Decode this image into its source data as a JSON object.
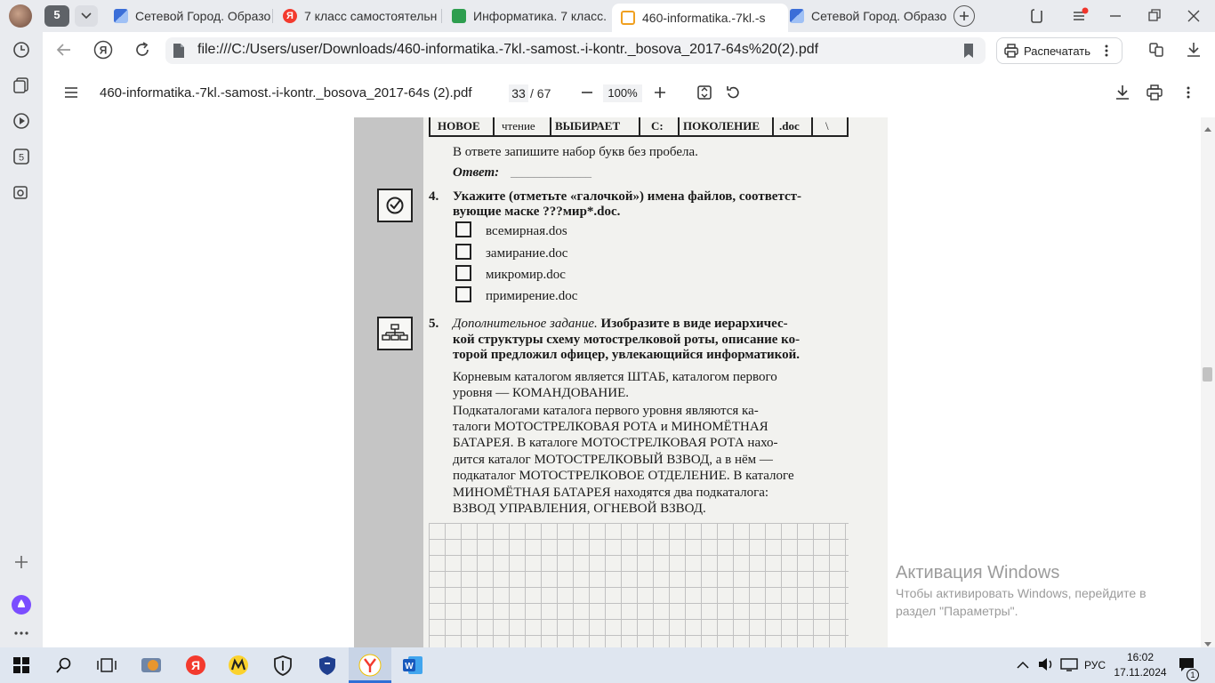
{
  "browser": {
    "tab_count": "5",
    "tabs": [
      {
        "title": "Сетевой Город. Образо",
        "favicon_color": "#3b6ed8",
        "active": false
      },
      {
        "title": "7 класс самостоятельн",
        "favicon_color": "#f33a2e",
        "active": false
      },
      {
        "title": "Информатика. 7 класс.",
        "favicon_color": "#2e9e4f",
        "active": false
      },
      {
        "title": "460-informatika.-7kl.-s",
        "favicon_color": "#f0a020",
        "active": true
      },
      {
        "title": "Сетевой Город. Образо",
        "favicon_color": "#3b6ed8",
        "active": false
      }
    ],
    "address": "file:///C:/Users/user/Downloads/460-informatika.-7kl.-samost.-i-kontr._bosova_2017-64s%20(2).pdf",
    "print_label": "Распечатать"
  },
  "pdf_toolbar": {
    "filename": "460-informatika.-7kl.-samost.-i-kontr._bosova_2017-64s (2).pdf",
    "current_page": "33",
    "total_pages": "/ 67",
    "zoom": "100%"
  },
  "page": {
    "table_cells": [
      "НОВОЕ",
      "чтение",
      "ВЫБИРАЕТ",
      "С:",
      "ПОКОЛЕНИЕ",
      ".doc",
      "\\"
    ],
    "answer_instruction": "В ответе запишите набор букв без пробела.",
    "answer_label": "Ответ:",
    "answer_line": "______________",
    "task4": {
      "number": "4.",
      "line1": "Укажите (отметьте «галочкой») имена файлов, соответст-",
      "line2": "вующие маске ???мир*.doc.",
      "options": [
        "всемирная.dos",
        "замирание.doc",
        "микромир.doc",
        "примирение.doc"
      ]
    },
    "task5": {
      "number": "5.",
      "heading": "Дополнительное задание.",
      "line1_rest": " Изобразите в виде иерархичес-",
      "line2": "кой структуры схему мотострелковой роты, описание ко-",
      "line3": "торой предложил офицер, увлекающийся информатикой.",
      "para1": [
        "Корневым каталогом является ШТАБ, каталогом первого",
        "уровня — КОМАНДОВАНИЕ."
      ],
      "para2": [
        "Подкаталогами каталога первого уровня являются ка-",
        "талоги  МОТОСТРЕЛКОВАЯ  РОТА  и  МИНОМЁТНАЯ",
        "БАТАРЕЯ. В каталоге МОТОСТРЕЛКОВАЯ РОТА нахо-",
        "дится каталог МОТОСТРЕЛКОВЫЙ ВЗВОД, а в нём —",
        "подкаталог МОТОСТРЕЛКОВОЕ ОТДЕЛЕНИЕ. В каталоге",
        "МИНОМЁТНАЯ БАТАРЕЯ находятся два подкаталога:",
        "ВЗВОД УПРАВЛЕНИЯ, ОГНЕВОЙ ВЗВОД."
      ]
    }
  },
  "watermark": {
    "title": "Активация Windows",
    "line1": "Чтобы активировать Windows, перейдите в",
    "line2": "раздел \"Параметры\"."
  },
  "taskbar": {
    "language": "РУС",
    "time": "16:02",
    "date": "17.11.2024",
    "notification_count": "1"
  }
}
